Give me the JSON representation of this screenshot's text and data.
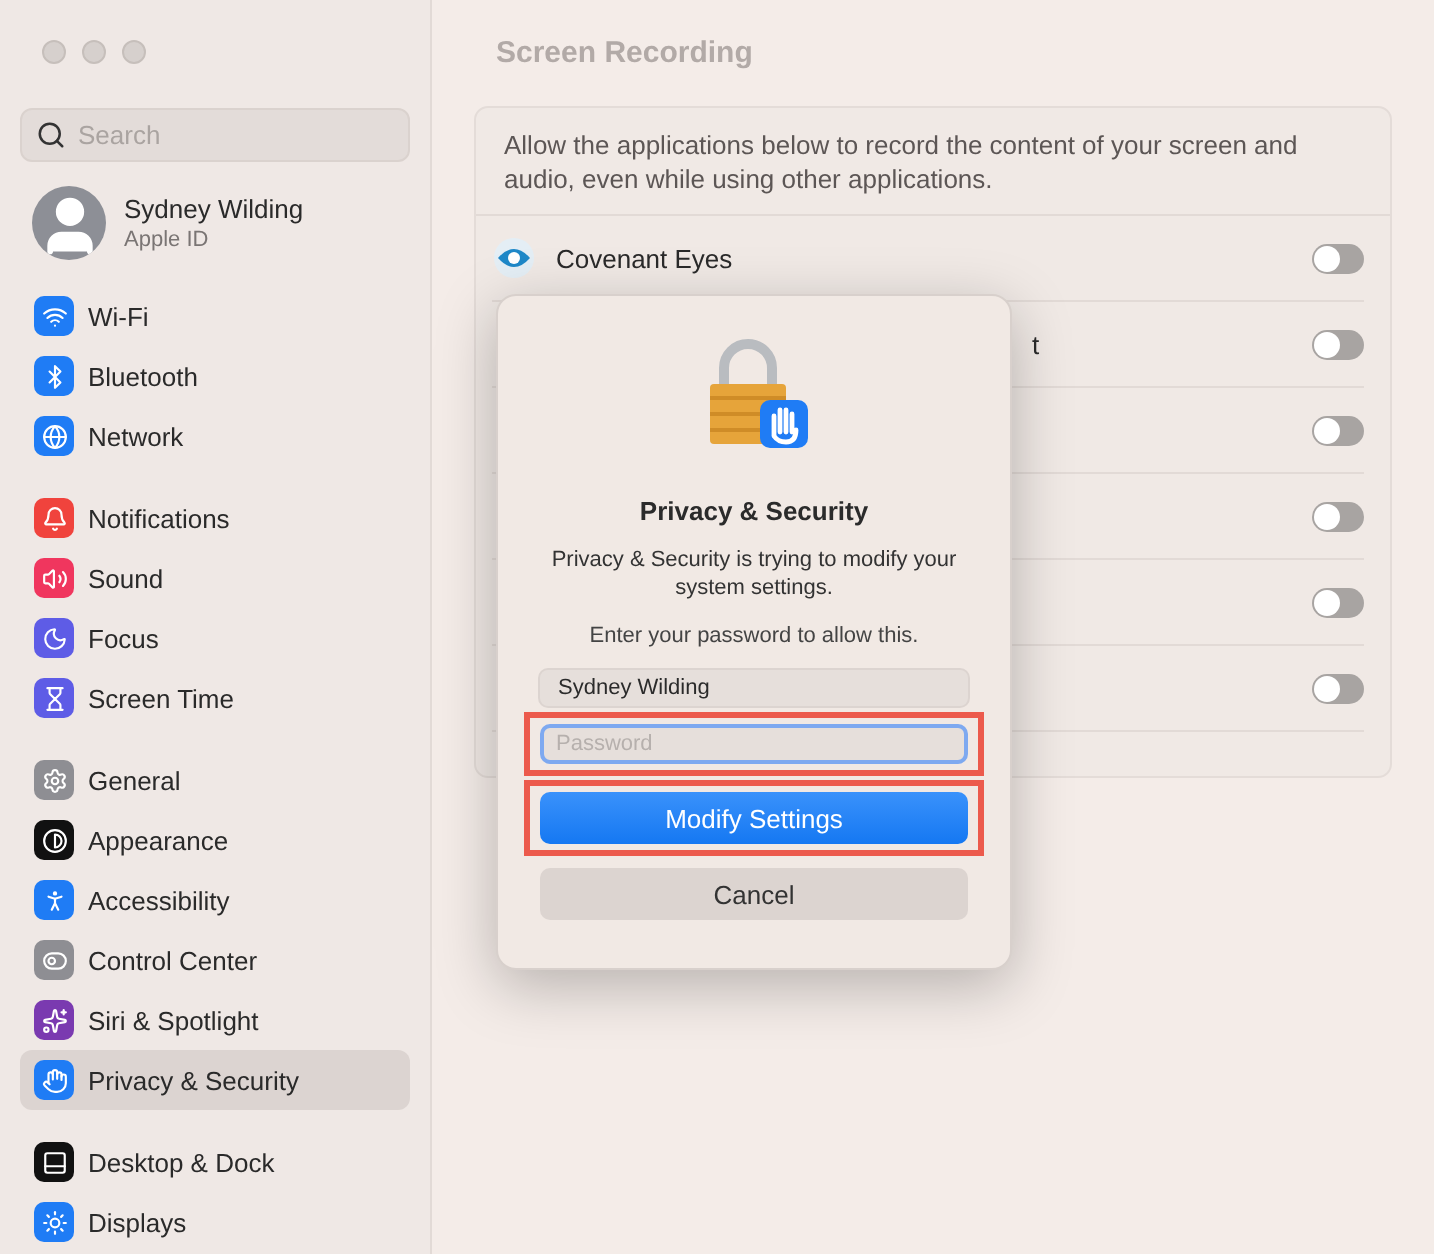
{
  "sidebar": {
    "search": {
      "placeholder": "Search"
    },
    "account": {
      "name": "Sydney Wilding",
      "subtitle": "Apple ID"
    },
    "groups": [
      [
        {
          "label": "Wi-Fi",
          "selected": false
        },
        {
          "label": "Bluetooth",
          "selected": false
        },
        {
          "label": "Network",
          "selected": false
        }
      ],
      [
        {
          "label": "Notifications",
          "selected": false
        },
        {
          "label": "Sound",
          "selected": false
        },
        {
          "label": "Focus",
          "selected": false
        },
        {
          "label": "Screen Time",
          "selected": false
        }
      ],
      [
        {
          "label": "General",
          "selected": false
        },
        {
          "label": "Appearance",
          "selected": false
        },
        {
          "label": "Accessibility",
          "selected": false
        },
        {
          "label": "Control Center",
          "selected": false
        },
        {
          "label": "Siri & Spotlight",
          "selected": false
        },
        {
          "label": "Privacy & Security",
          "selected": true
        }
      ],
      [
        {
          "label": "Desktop & Dock",
          "selected": false
        },
        {
          "label": "Displays",
          "selected": false
        }
      ]
    ]
  },
  "content": {
    "title": "Screen Recording",
    "description": "Allow the applications below to record the content of your screen and audio, even while using other applications.",
    "apps": [
      {
        "kind": "app",
        "name": "Covenant Eyes",
        "on": false
      },
      {
        "kind": "covered",
        "name": "t",
        "on": false
      },
      {
        "kind": "covered",
        "on": false
      },
      {
        "kind": "covered",
        "on": false
      },
      {
        "kind": "covered",
        "on": false
      },
      {
        "kind": "covered",
        "on": false
      }
    ]
  },
  "dialog": {
    "title": "Privacy & Security",
    "message": "Privacy & Security is trying to modify your system settings.",
    "prompt": "Enter your password to allow this.",
    "username": "Sydney Wilding",
    "password": {
      "placeholder": "Password",
      "highlighted": true
    },
    "buttons": [
      {
        "kind": "primary",
        "label": "Modify Settings",
        "highlighted": true
      },
      {
        "kind": "secondary",
        "label": "Cancel",
        "highlighted": false
      }
    ]
  }
}
